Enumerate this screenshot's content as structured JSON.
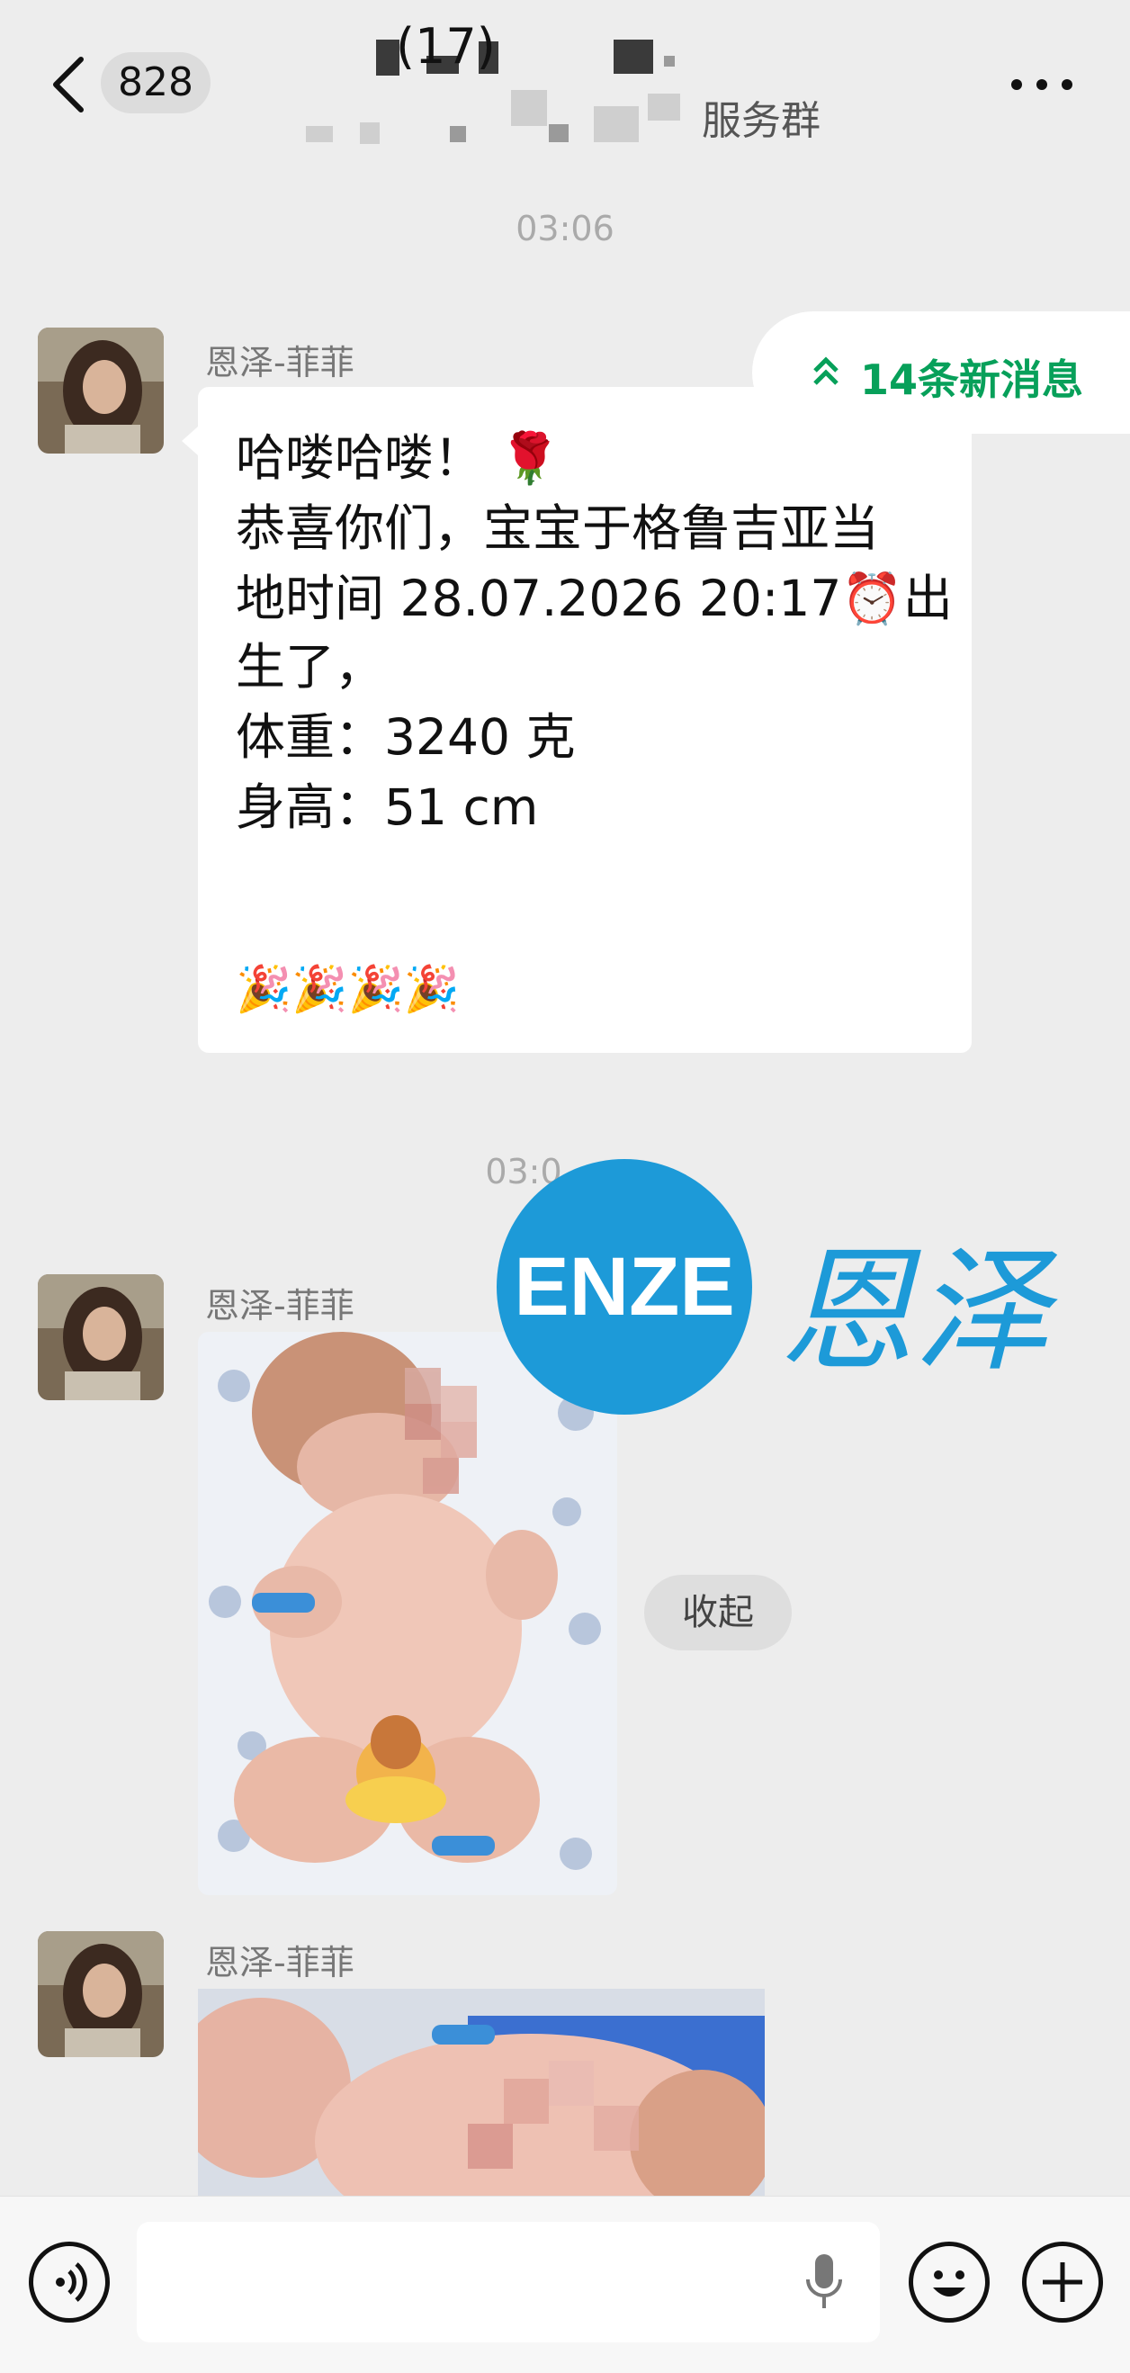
{
  "header": {
    "back_count": "828",
    "title_suffix": "(17)",
    "subtitle": "服务群"
  },
  "timestamps": [
    "03:06",
    "03:0"
  ],
  "new_messages": "14条新消息",
  "messages": [
    {
      "sender": "恩泽-菲菲",
      "lines": [
        "哈喽哈喽！ 🌹",
        "恭喜你们，宝宝于格鲁吉亚当",
        "地时间 28.07.2026 20:17⏰出",
        "生了，",
        "体重：3240 克",
        "身高：51 cm",
        "",
        "🎉🎉🎉🎉"
      ]
    },
    {
      "sender": "恩泽-菲菲",
      "type": "image"
    },
    {
      "sender": "恩泽-菲菲",
      "type": "image"
    }
  ],
  "collapse_label": "收起",
  "watermark": {
    "logo": "ENZE",
    "text": "恩泽"
  },
  "colors": {
    "accent": "#07a05a",
    "brand": "#1d9ad8",
    "background": "#ededed"
  }
}
